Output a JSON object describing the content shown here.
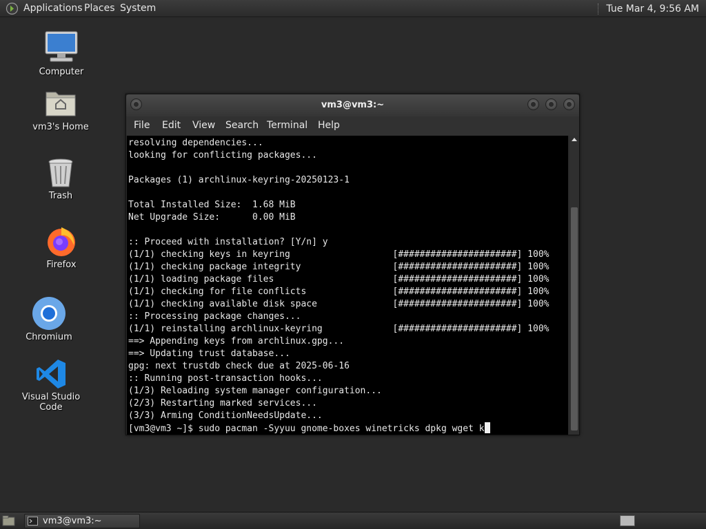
{
  "top_panel": {
    "menus": [
      "Applications",
      "Places",
      "System"
    ],
    "clock": "Tue Mar  4,  9:56 AM"
  },
  "desktop_icons": [
    {
      "label": "Computer",
      "icon": "computer-icon"
    },
    {
      "label": "vm3's Home",
      "icon": "home-folder-icon"
    },
    {
      "label": "Trash",
      "icon": "trash-icon"
    },
    {
      "label": "Firefox",
      "icon": "firefox-icon"
    },
    {
      "label": "Chromium",
      "icon": "chromium-icon"
    },
    {
      "label": "Visual Studio Code",
      "icon": "vscode-icon"
    }
  ],
  "terminal": {
    "title": "vm3@vm3:~",
    "menu": [
      "File",
      "Edit",
      "View",
      "Search",
      "Terminal",
      "Help"
    ],
    "lines": [
      "resolving dependencies...",
      "looking for conflicting packages...",
      "",
      "Packages (1) archlinux-keyring-20250123-1",
      "",
      "Total Installed Size:  1.68 MiB",
      "Net Upgrade Size:      0.00 MiB",
      "",
      ":: Proceed with installation? [Y/n] y",
      "(1/1) checking keys in keyring                   [######################] 100%",
      "(1/1) checking package integrity                 [######################] 100%",
      "(1/1) loading package files                      [######################] 100%",
      "(1/1) checking for file conflicts                [######################] 100%",
      "(1/1) checking available disk space              [######################] 100%",
      ":: Processing package changes...",
      "(1/1) reinstalling archlinux-keyring             [######################] 100%",
      "==> Appending keys from archlinux.gpg...",
      "==> Updating trust database...",
      "gpg: next trustdb check due at 2025-06-16",
      ":: Running post-transaction hooks...",
      "(1/3) Reloading system manager configuration...",
      "(2/3) Restarting marked services...",
      "(3/3) Arming ConditionNeedsUpdate..."
    ],
    "prompt": "[vm3@vm3 ~]$ sudo pacman -Syyuu gnome-boxes winetricks dpkg wget k"
  },
  "taskbar": {
    "task_label": "vm3@vm3:~"
  }
}
